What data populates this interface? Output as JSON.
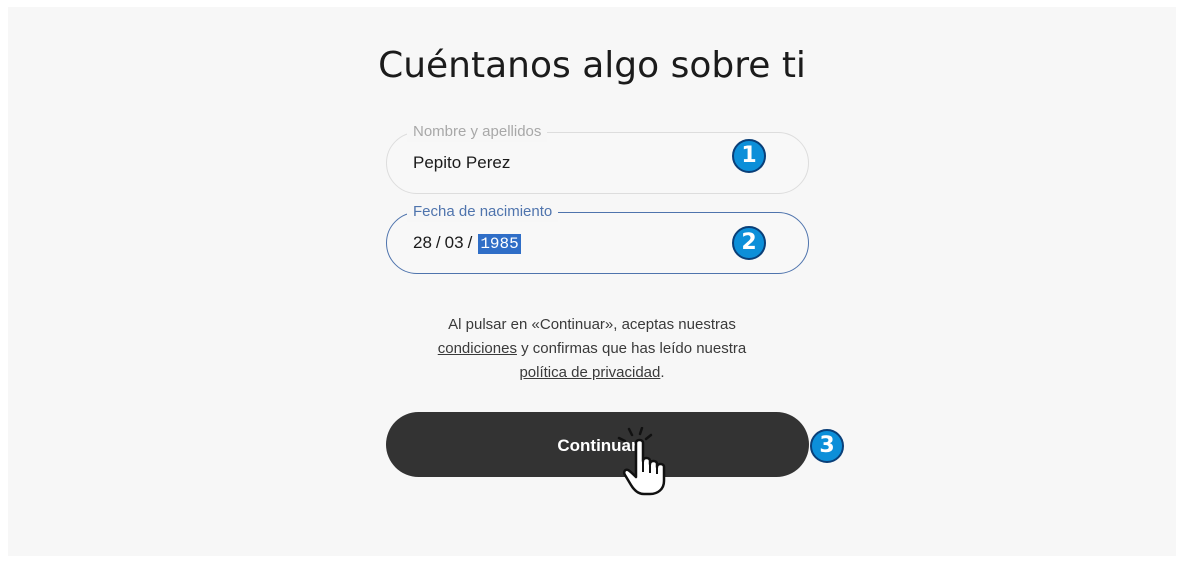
{
  "title": "Cuéntanos algo sobre ti",
  "name_field": {
    "label": "Nombre y apellidos",
    "value": "Pepito Perez"
  },
  "date_field": {
    "label": "Fecha de nacimiento",
    "day": "28",
    "month": "03",
    "year": "1985",
    "separator": "/"
  },
  "terms": {
    "line1": "Al pulsar en «Continuar», aceptas nuestras",
    "conditions_link": "condiciones",
    "line2_rest": " y confirmas que has leído nuestra",
    "privacy_link": "política de privacidad",
    "end": "."
  },
  "continue_button": {
    "label": "Continuar"
  },
  "badges": {
    "step1": "1",
    "step2": "2",
    "step3": "3"
  },
  "colors": {
    "accent": "#4f74ad",
    "button": "#333333",
    "badge": "#0c8fd9",
    "selection": "#2f6ec7"
  },
  "icons": {
    "cursor": "hand-pointer-icon"
  }
}
